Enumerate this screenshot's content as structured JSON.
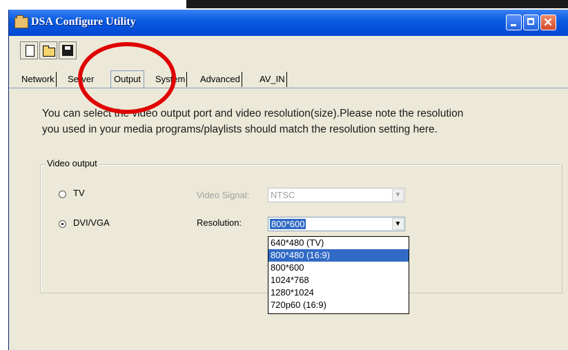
{
  "window": {
    "title": "DSA Configure Utility"
  },
  "tabs": [
    {
      "label": "Network"
    },
    {
      "label": "Server"
    },
    {
      "label": "Output"
    },
    {
      "label": "System"
    },
    {
      "label": "Advanced"
    },
    {
      "label": "AV_IN"
    }
  ],
  "output": {
    "description_line1": "You can select the video output port and video resolution(size).Please note the resolution",
    "description_line2": "you used in your media programs/playlists should match the resolution setting here.",
    "group_label": "Video output",
    "tv_label": "TV",
    "dvi_label": "DVI/VGA",
    "selected_port": "DVI/VGA",
    "video_signal_label": "Video Signal:",
    "video_signal_value": "NTSC",
    "resolution_label": "Resolution:",
    "resolution_value": "800*600",
    "resolution_options": [
      "640*480 (TV)",
      "800*480 (16:9)",
      "800*600",
      "1024*768",
      "1280*1024",
      "720p60 (16:9)"
    ],
    "highlighted_option": "800*480 (16:9)"
  },
  "icons": {
    "toolbar": [
      "new-file-icon",
      "open-folder-icon",
      "save-disk-icon"
    ],
    "title": "folder-app-icon"
  },
  "colors": {
    "title_bar": "#0a5ce0",
    "selection": "#316ac5",
    "annotation": "#e00000",
    "window_bg": "#ece9d8"
  }
}
